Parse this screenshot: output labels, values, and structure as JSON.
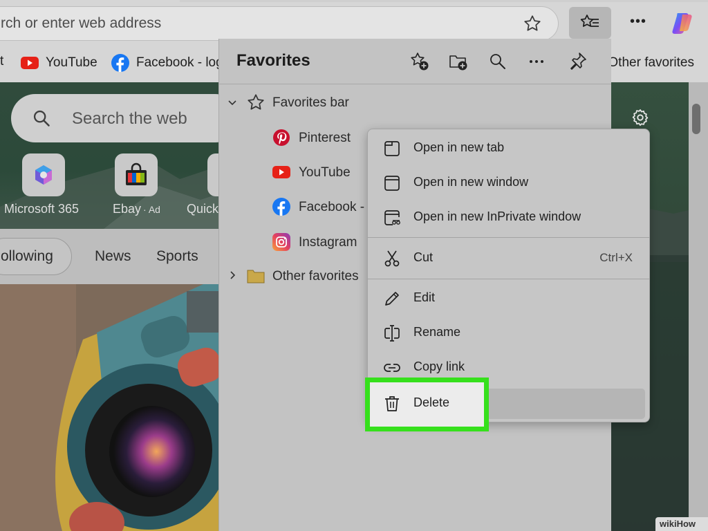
{
  "address_bar": {
    "text": "rch or enter web address",
    "favorite_icon": "star-icon"
  },
  "toolbar": {
    "favorites_icon": "favorites-icon",
    "more_label": "•••",
    "copilot_icon": "copilot-icon"
  },
  "bookmarks_bar": {
    "items": [
      {
        "label": "YouTube",
        "icon": "youtube-icon"
      },
      {
        "label": "Facebook - log",
        "icon": "facebook-icon"
      }
    ],
    "other_favorites": "Other favorites"
  },
  "page": {
    "search_placeholder": "Search the web",
    "apps": [
      {
        "label": "Microsoft 365"
      },
      {
        "label": "Ebay",
        "ad": "Ad"
      },
      {
        "label": "Quick"
      }
    ],
    "feed_tabs": [
      "ollowing",
      "News",
      "Sports"
    ]
  },
  "favorites_pane": {
    "title": "Favorites",
    "tree": {
      "folder": "Favorites bar",
      "items": [
        "Pinterest",
        "YouTube",
        "Facebook - ",
        "Instagram"
      ],
      "other_folder": "Other favorites"
    }
  },
  "context_menu": {
    "items": [
      {
        "label": "Open in new tab",
        "icon": "new-tab-icon"
      },
      {
        "label": "Open in new window",
        "icon": "new-window-icon"
      },
      {
        "label": "Open in new InPrivate window",
        "icon": "inprivate-window-icon"
      },
      {
        "label": "Cut",
        "shortcut": "Ctrl+X",
        "icon": "scissors-icon"
      },
      {
        "label": "Edit",
        "icon": "pencil-icon"
      },
      {
        "label": "Rename",
        "icon": "rename-icon"
      },
      {
        "label": "Copy link",
        "icon": "link-icon"
      },
      {
        "label": "Delete",
        "icon": "trash-icon"
      }
    ],
    "highlight_color": "#36e01c"
  },
  "watermark": "wikiHow"
}
